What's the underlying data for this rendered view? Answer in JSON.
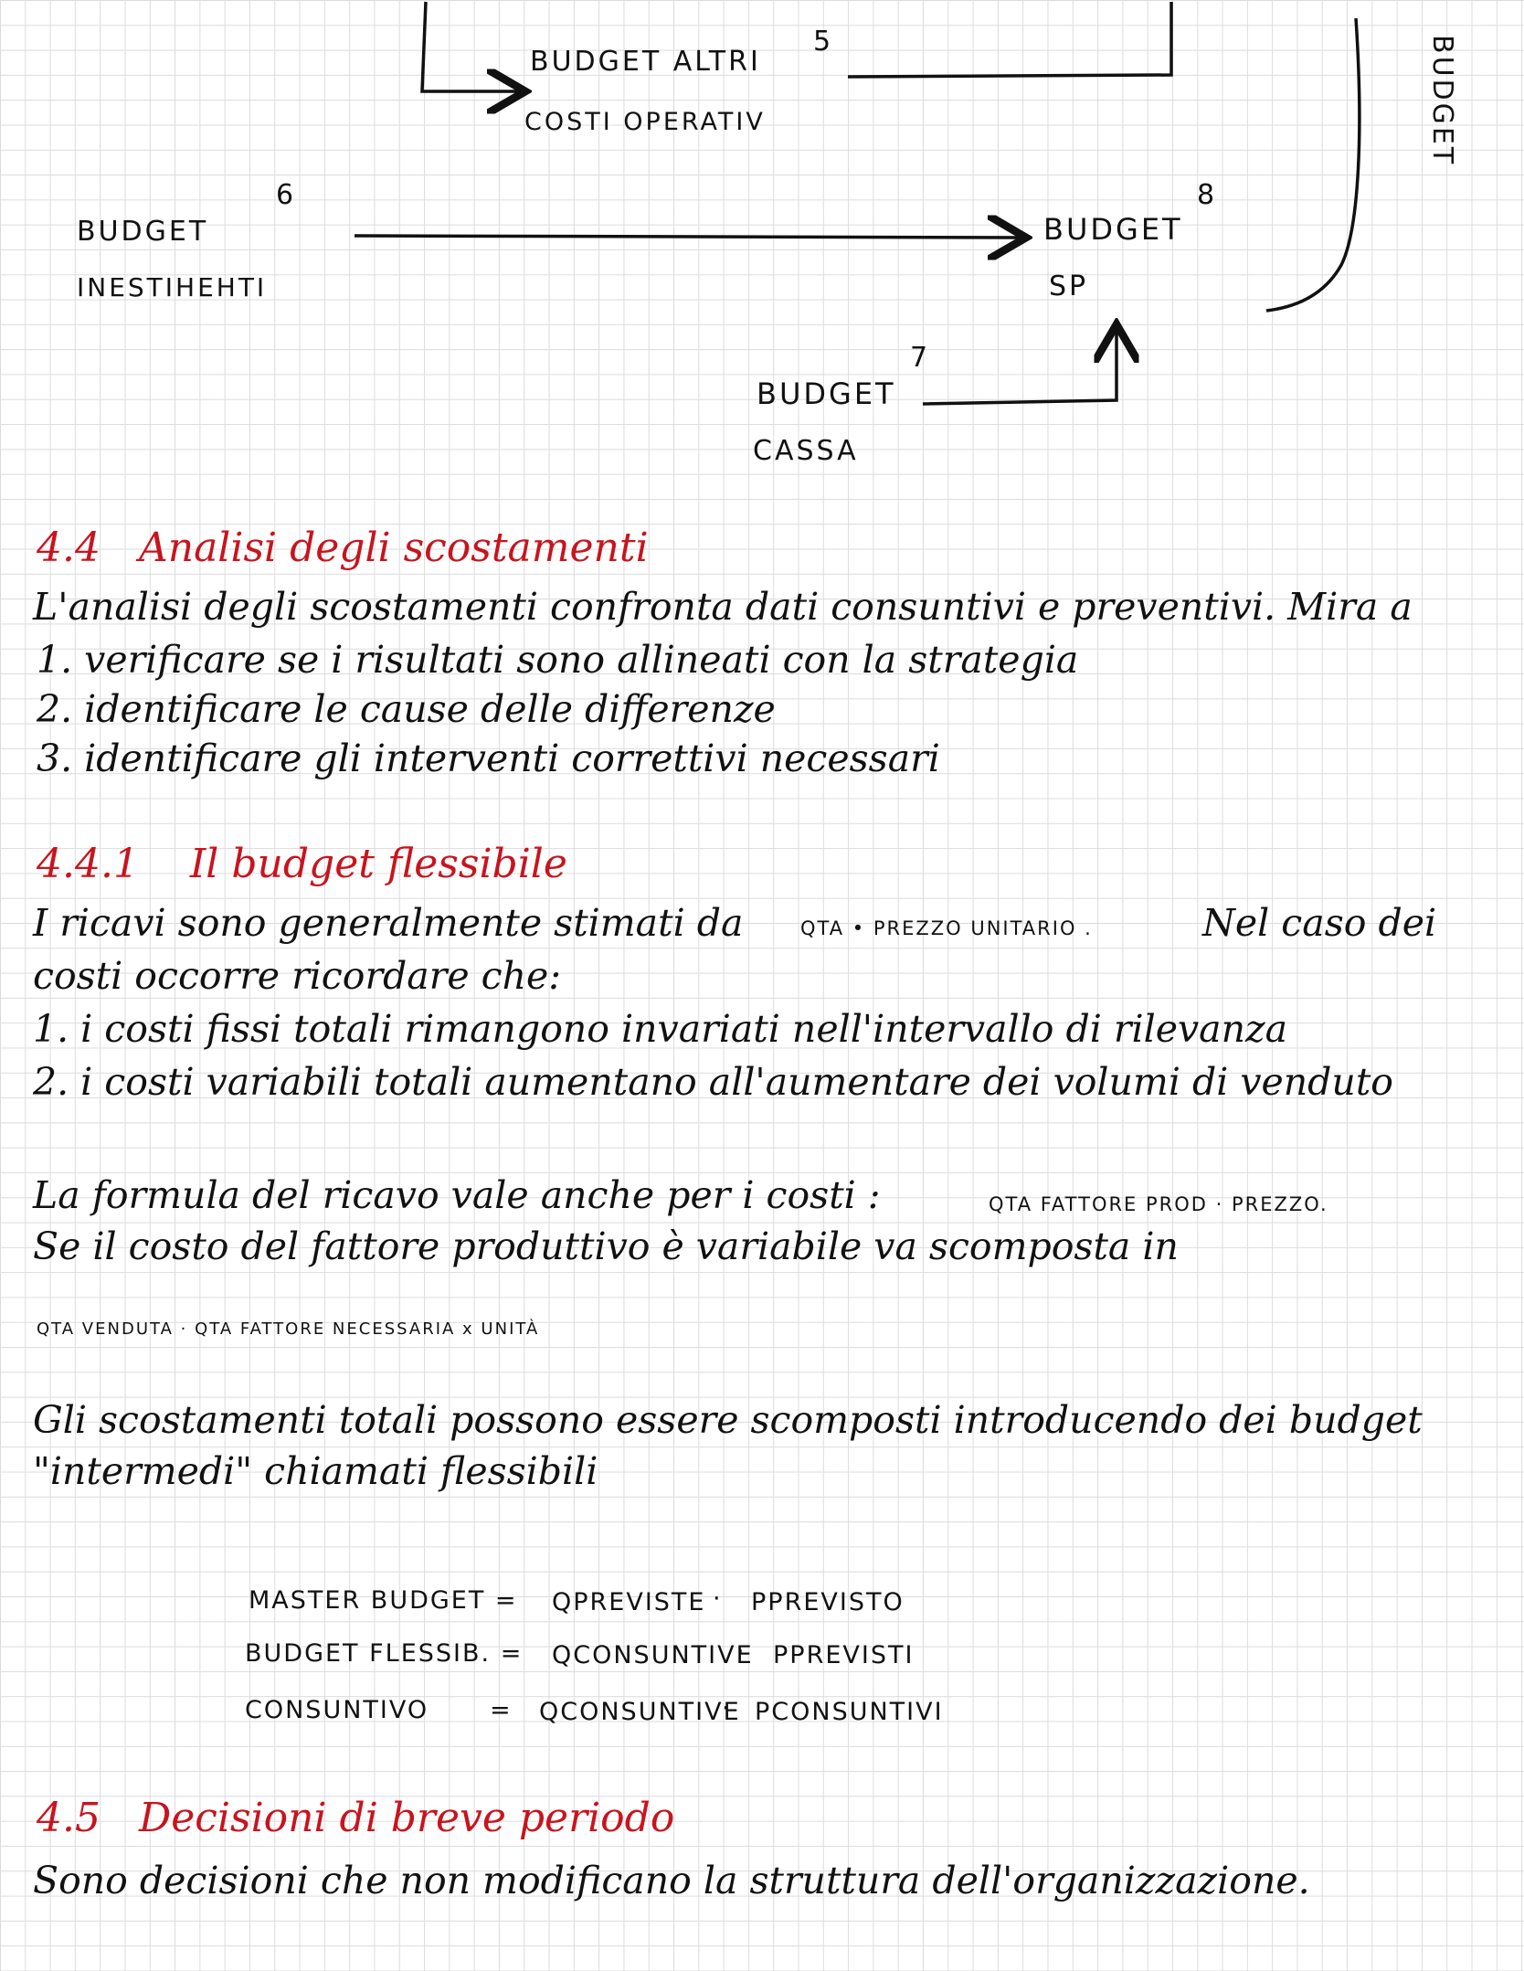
{
  "diagram": {
    "altri_title": "BUDGET ALTRI",
    "altri_sub": "COSTI OPERATIV",
    "altri_num": "5",
    "inv_title": "BUDGET",
    "inv_sub": "INESTIHEHTI",
    "inv_num": "6",
    "sp_title": "BUDGET",
    "sp_sub": "SP",
    "sp_num": "8",
    "cassa_title": "BUDGET",
    "cassa_sub": "CASSA",
    "cassa_num": "7",
    "side_label": "BUDGET"
  },
  "s44": {
    "heading_num": "4.4",
    "heading_title": "Analisi degli scostamenti",
    "line1": "L'analisi degli scostamenti confronta dati consuntivi e preventivi. Mira a",
    "item1": "1. verificare se i risultati sono allineati con la strategia",
    "item2": "2. identificare le cause delle differenze",
    "item3": "3. identificare gli interventi correttivi necessari"
  },
  "s441": {
    "heading_num": "4.4.1",
    "heading_title": "Il budget flessibile",
    "p1_start": "I ricavi sono generalmente stimati da",
    "p1_formula": "QTA • PREZZO UNITARIO .",
    "p1_end": "Nel caso dei",
    "p1_line2": "costi occorre ricordare che:",
    "item1": "1. i costi fissi totali rimangono invariati nell'intervallo di rilevanza",
    "item2": "2. i costi variabili totali aumentano all'aumentare dei volumi di venduto",
    "p2_start": "La formula del ricavo vale anche per i costi :",
    "p2_formula": "QTA FATTORE PROD · PREZZO.",
    "p2_line2": "Se il costo del fattore produttivo è variabile va scomposta in",
    "p2_line3": "QTA VENDUTA  ·  QTA FATTORE NECESSARIA x UNITÀ",
    "p3_line1": "Gli scostamenti totali possono essere scomposti introducendo dei budget",
    "p3_line2": "\"intermedi\" chiamati flessibili",
    "formulas": [
      {
        "label": "MASTER BUDGET =",
        "q": "QPREVISTE",
        "dot": "·",
        "p": "PPREVISTO"
      },
      {
        "label": "BUDGET FLESSIB. =",
        "q": "QCONSUNTIVE",
        "dot": "·",
        "p": "PPREVISTI"
      },
      {
        "label": "CONSUNTIVO",
        "eq": "=",
        "q": "QCONSUNTIVE",
        "dot": "·",
        "p": "PCONSUNTIVI"
      }
    ]
  },
  "s45": {
    "heading_num": "4.5",
    "heading_title": "Decisioni di breve periodo",
    "line1": "Sono decisioni che non modificano la struttura dell'organizzazione."
  }
}
